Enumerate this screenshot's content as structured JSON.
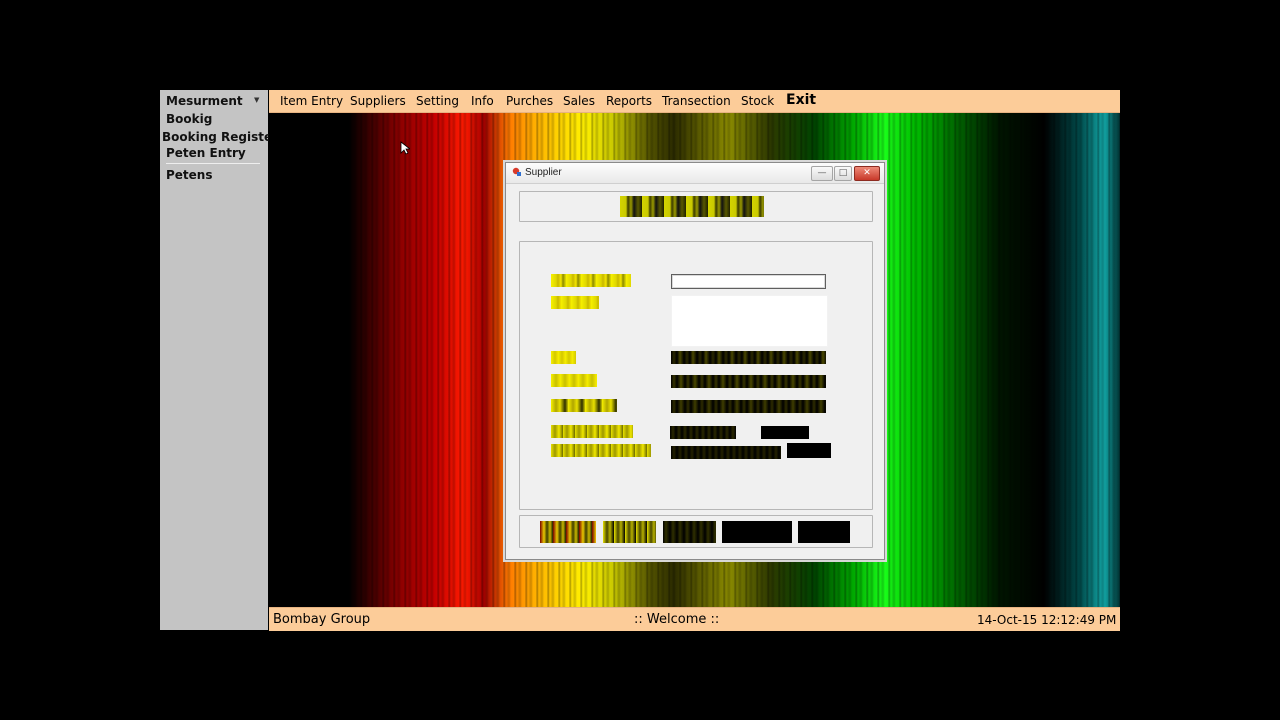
{
  "sidebar": {
    "items": [
      {
        "label": "Mesurment",
        "has_dropdown": true
      },
      {
        "label": "Bookig"
      },
      {
        "label": "Booking Register"
      },
      {
        "label": "Peten Entry"
      },
      {
        "label": "Petens"
      }
    ],
    "dropdown_icon": "triangle-down-icon"
  },
  "menubar": {
    "items": [
      "Item Entry",
      "Suppliers",
      "Setting",
      "Info",
      "Purches",
      "Sales",
      "Reports",
      "Transection",
      "Stock"
    ],
    "exit_label": "Exit"
  },
  "statusbar": {
    "company": "Bombay Group",
    "welcome": ":: Welcome ::",
    "datetime": "14-Oct-15 12:12:49 PM"
  },
  "dialog": {
    "title": "Supplier",
    "icon": "app-icon",
    "controls": {
      "minimize": "—",
      "maximize": "□",
      "close": "✕"
    }
  },
  "colors": {
    "bar_background": "#fccc99",
    "sidebar_background": "#c4c4c4",
    "dialog_background": "#f0f0f0"
  }
}
